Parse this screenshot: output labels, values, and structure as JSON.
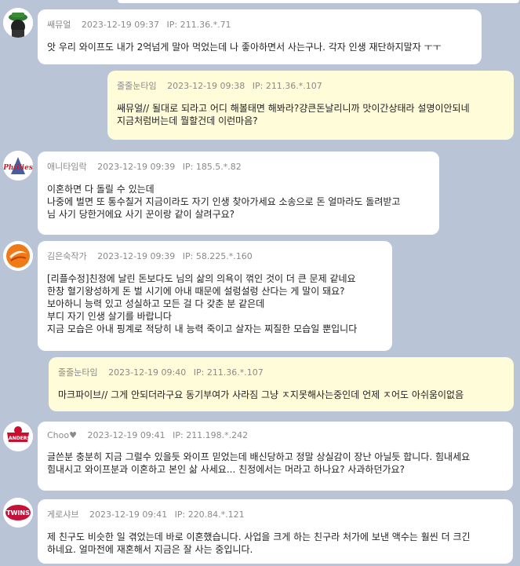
{
  "comments": [
    {
      "nick": "쌔뮤얼",
      "date": "2023-12-19 09:37",
      "ip": "IP: 211.36.*.71",
      "avatar": "hat-avatar",
      "lines": [
        "앗 우리 와이프도 내가 2억넘게 말아 먹었는데 나 좋아하면서 사는구나. 각자 인생 재단하지말자 ㅜㅜ"
      ]
    },
    {
      "nick": "줄줄눈타임",
      "date": "2023-12-19 09:38",
      "ip": "IP: 211.36.*.107",
      "lines": [
        "쌔뮤얼// 될대로 되라고 어디 해볼태면 해봐라?걍큰돈날리니까 맛이간상태라 설명이안되네",
        "지금처럼버는데 뭘할건데 이런마음?"
      ]
    },
    {
      "nick": "애니타임락",
      "date": "2023-12-19 09:39",
      "ip": "IP: 185.5.*.82",
      "avatar": "phillies-logo",
      "avatar_text": "Phillies",
      "lines": [
        "이혼하면 다 돌릴 수 있는데",
        "나중에 벌면 또 통수칠거 지금이라도 자기 인생 찾아가세요 소송으로 돈 얼마라도 돌려받고",
        "님 사기 당한거에요 사기 꾼이랑 같이 살려구요?"
      ]
    },
    {
      "nick": "김은숙작가",
      "date": "2023-12-19 09:39",
      "ip": "IP: 58.225.*.160",
      "avatar": "orange-swirl-logo",
      "lines": [
        "[리플수정]친정에 날린 돈보다도 님의 삶의 의욕이 꺾인 것이 더 큰 문제 같네요",
        "한창 혈기왕성하게 돈 벌 시기에 아내 때문에 설렁설렁 산다는 게 말이 돼요?",
        "보아하니 능력 있고 성실하고 모든 걸 다 갖춘 분 같은데",
        "부디 자기 인생 살기를 바랍니다",
        "지금 모습은 아내 핑계로 적당히 내 능력 죽이고 살자는 찌질한 모습일 뿐입니다"
      ]
    },
    {
      "nick": "줄줄눈타임",
      "date": "2023-12-19 09:40",
      "ip": "IP: 211.36.*.107",
      "lines": [
        "마크파이브// 그게 안되더라구요 동기부여가 사라짐 그냥 ㅈ지못해사는중인데 언제 ㅈ어도 아쉬움이없음"
      ]
    },
    {
      "nick": "Choo♥",
      "date": "2023-12-19 09:41",
      "ip": "IP: 211.198.*.242",
      "avatar": "landers-logo",
      "avatar_text": "LANDERS",
      "lines": [
        "글쓴분 충분히 지금 그럴수 있을듯 와이프 믿었는데 배신당하고 정말 상실감이 장난 아닐듯 합니다. 힘내세요",
        "힘내시고 와이프분과 이혼하고 본인 삶 사세요... 친정에서는 머라고 하나요? 사과하던가요?"
      ]
    },
    {
      "nick": "게로샤브",
      "date": "2023-12-19 09:41",
      "ip": "IP: 220.84.*.121",
      "avatar": "twins-logo",
      "avatar_text": "TWINS",
      "lines": [
        "제 친구도 비슷한 일 겪었는데 바로 이혼했습니다. 사업을 크게 하는 친구라 처가에 보낸 액수는 훨씬 더 크긴",
        "하네요. 얼마전에 재혼해서 지금은 잘 사는 중입니다."
      ]
    }
  ]
}
